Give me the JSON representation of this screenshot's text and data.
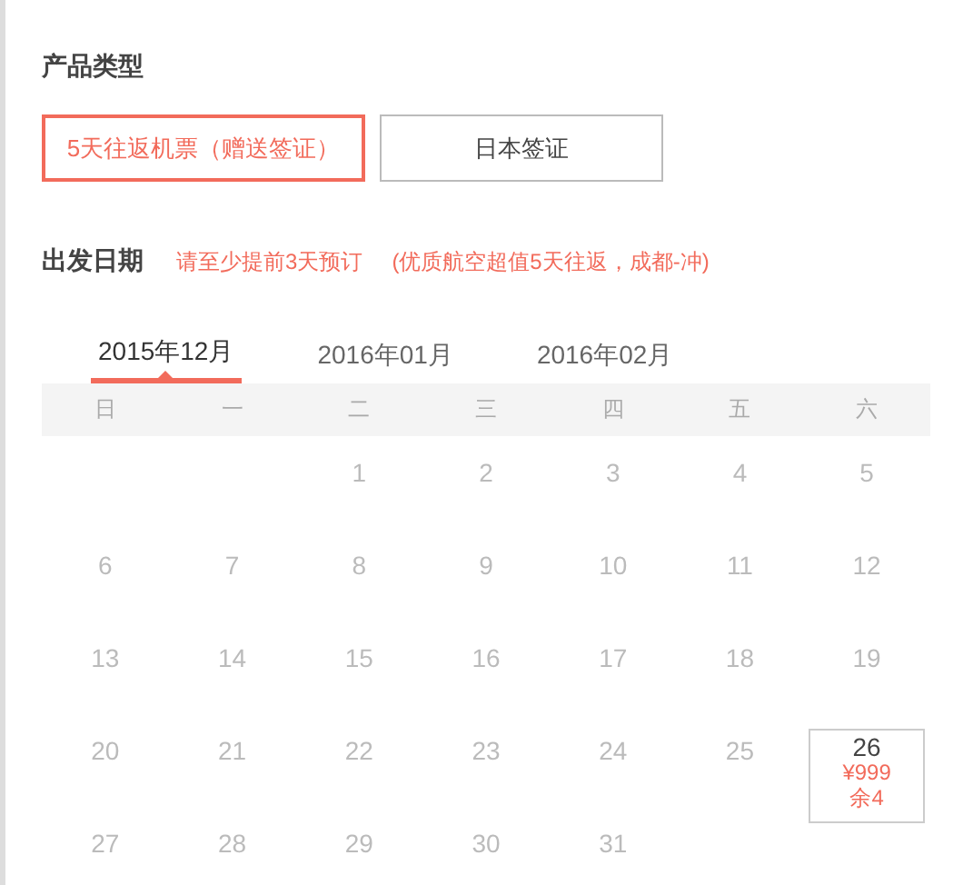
{
  "product_type": {
    "label": "产品类型",
    "options": [
      {
        "label": "5天往返机票（赠送签证）",
        "selected": true
      },
      {
        "label": "日本签证",
        "selected": false
      }
    ]
  },
  "departure": {
    "label": "出发日期",
    "notice": "请至少提前3天预订",
    "note": "(优质航空超值5天往返，成都-冲)"
  },
  "month_tabs": [
    {
      "label": "2015年12月",
      "selected": true
    },
    {
      "label": "2016年01月",
      "selected": false
    },
    {
      "label": "2016年02月",
      "selected": false
    }
  ],
  "weekdays": [
    "日",
    "一",
    "二",
    "三",
    "四",
    "五",
    "六"
  ],
  "weeks": [
    [
      {
        "kind": "blank"
      },
      {
        "kind": "blank"
      },
      {
        "day": "1",
        "available": false
      },
      {
        "day": "2",
        "available": false
      },
      {
        "day": "3",
        "available": false
      },
      {
        "day": "4",
        "available": false
      },
      {
        "day": "5",
        "available": false
      }
    ],
    [
      {
        "day": "6",
        "available": false
      },
      {
        "day": "7",
        "available": false
      },
      {
        "day": "8",
        "available": false
      },
      {
        "day": "9",
        "available": false
      },
      {
        "day": "10",
        "available": false
      },
      {
        "day": "11",
        "available": false
      },
      {
        "day": "12",
        "available": false
      }
    ],
    [
      {
        "day": "13",
        "available": false
      },
      {
        "day": "14",
        "available": false
      },
      {
        "day": "15",
        "available": false
      },
      {
        "day": "16",
        "available": false
      },
      {
        "day": "17",
        "available": false
      },
      {
        "day": "18",
        "available": false
      },
      {
        "day": "19",
        "available": false
      }
    ],
    [
      {
        "day": "20",
        "available": false
      },
      {
        "day": "21",
        "available": false
      },
      {
        "day": "22",
        "available": false
      },
      {
        "day": "23",
        "available": false
      },
      {
        "day": "24",
        "available": false
      },
      {
        "day": "25",
        "available": false
      },
      {
        "day": "26",
        "available": true,
        "price": "¥999",
        "stock": "余4"
      }
    ],
    [
      {
        "day": "27",
        "available": false
      },
      {
        "day": "28",
        "available": false
      },
      {
        "day": "29",
        "available": false
      },
      {
        "day": "30",
        "available": false
      },
      {
        "day": "31",
        "available": false
      }
    ]
  ]
}
